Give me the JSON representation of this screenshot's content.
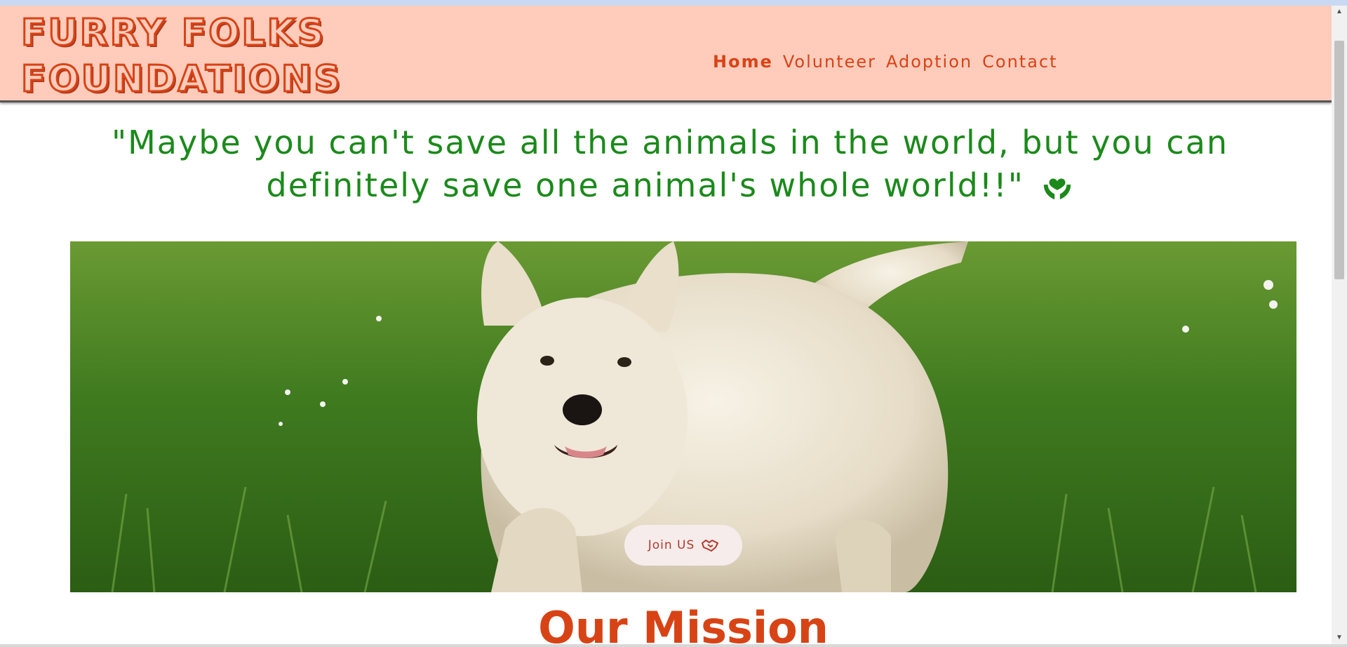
{
  "header": {
    "brand_line1": "FURRY FOLKS",
    "brand_line2": "FOUNDATIONS",
    "nav": [
      {
        "label": "Home",
        "active": true
      },
      {
        "label": "Volunteer",
        "active": false
      },
      {
        "label": "Adoption",
        "active": false
      },
      {
        "label": "Contact",
        "active": false
      }
    ]
  },
  "quote": {
    "text": "\"Maybe you can't save all the animals in the world, but you can definitely save one animal's whole world!!\"",
    "icon": "hands-holding-heart-icon"
  },
  "hero": {
    "image": "white-terrier-dog-on-grass",
    "button_label": "Join US",
    "button_icon": "handshake-icon"
  },
  "mission": {
    "title": "Our Mission"
  },
  "colors": {
    "nav_bg": "#ffccbc",
    "brand": "#d84315",
    "quote": "#1b8a1b",
    "button_bg": "#f7ecec"
  }
}
